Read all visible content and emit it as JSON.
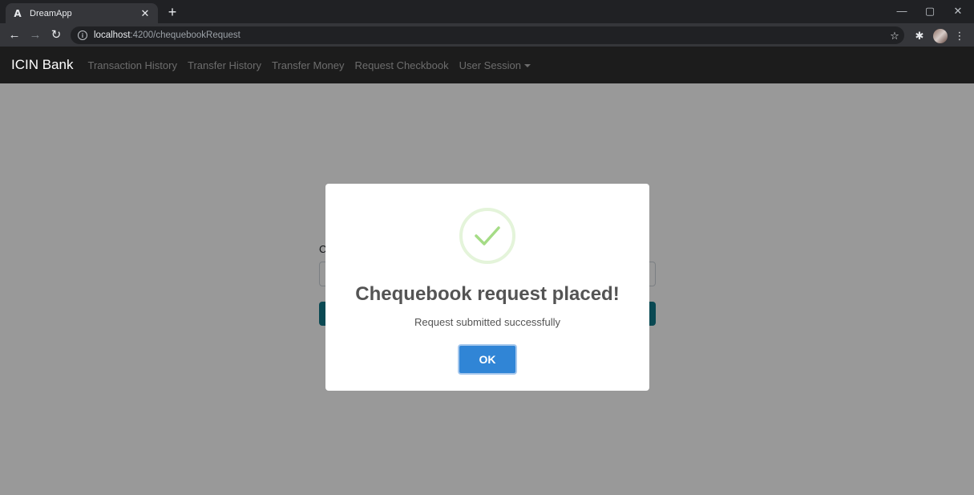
{
  "browser": {
    "tab_title": "DreamApp",
    "tab_favicon": "A",
    "url_host": "localhost",
    "url_path": ":4200/chequebookRequest"
  },
  "navbar": {
    "brand": "ICIN Bank",
    "links": [
      "Transaction History",
      "Transfer History",
      "Transfer Money",
      "Request Checkbook",
      "User Session"
    ]
  },
  "form": {
    "label_partial": "C"
  },
  "modal": {
    "title": "Chequebook request placed!",
    "text": "Request submitted successfully",
    "ok_label": "OK",
    "icon": "check-icon"
  },
  "colors": {
    "success": "#a5dc86",
    "confirm_button": "#3085d6",
    "navbar": "#1c1c1c",
    "submit_button": "#117a8b"
  }
}
